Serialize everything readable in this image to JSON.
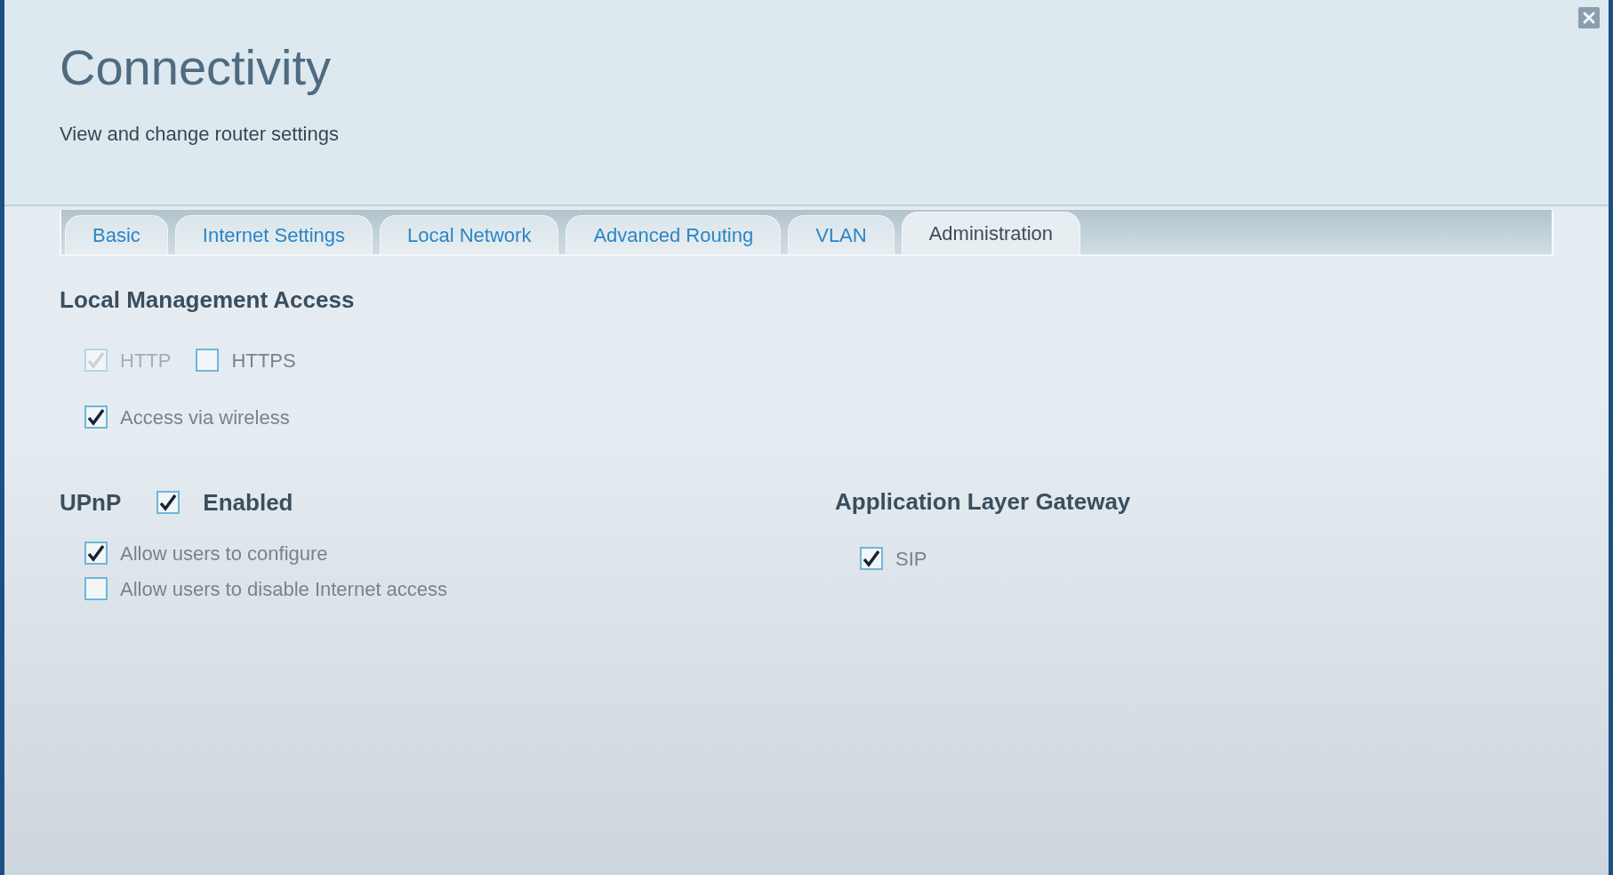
{
  "header": {
    "title": "Connectivity",
    "subtitle": "View and change router settings"
  },
  "tabs": [
    {
      "label": "Basic",
      "selected": false
    },
    {
      "label": "Internet Settings",
      "selected": false
    },
    {
      "label": "Local Network",
      "selected": false
    },
    {
      "label": "Advanced Routing",
      "selected": false
    },
    {
      "label": "VLAN",
      "selected": false
    },
    {
      "label": "Administration",
      "selected": true
    }
  ],
  "local_management": {
    "heading": "Local Management Access",
    "protocols": [
      {
        "label": "HTTP",
        "checked": true,
        "disabled": true
      },
      {
        "label": "HTTPS",
        "checked": false,
        "disabled": false
      }
    ],
    "options": [
      {
        "label": "Access via wireless",
        "checked": true,
        "disabled": false
      }
    ]
  },
  "upnp": {
    "heading": "UPnP",
    "enabled": {
      "label": "Enabled",
      "checked": true
    },
    "options": [
      {
        "label": "Allow users to configure",
        "checked": true,
        "disabled": false
      },
      {
        "label": "Allow users to disable Internet access",
        "checked": false,
        "disabled": false
      }
    ]
  },
  "alg": {
    "heading": "Application Layer Gateway",
    "options": [
      {
        "label": "SIP",
        "checked": true,
        "disabled": false
      }
    ]
  }
}
